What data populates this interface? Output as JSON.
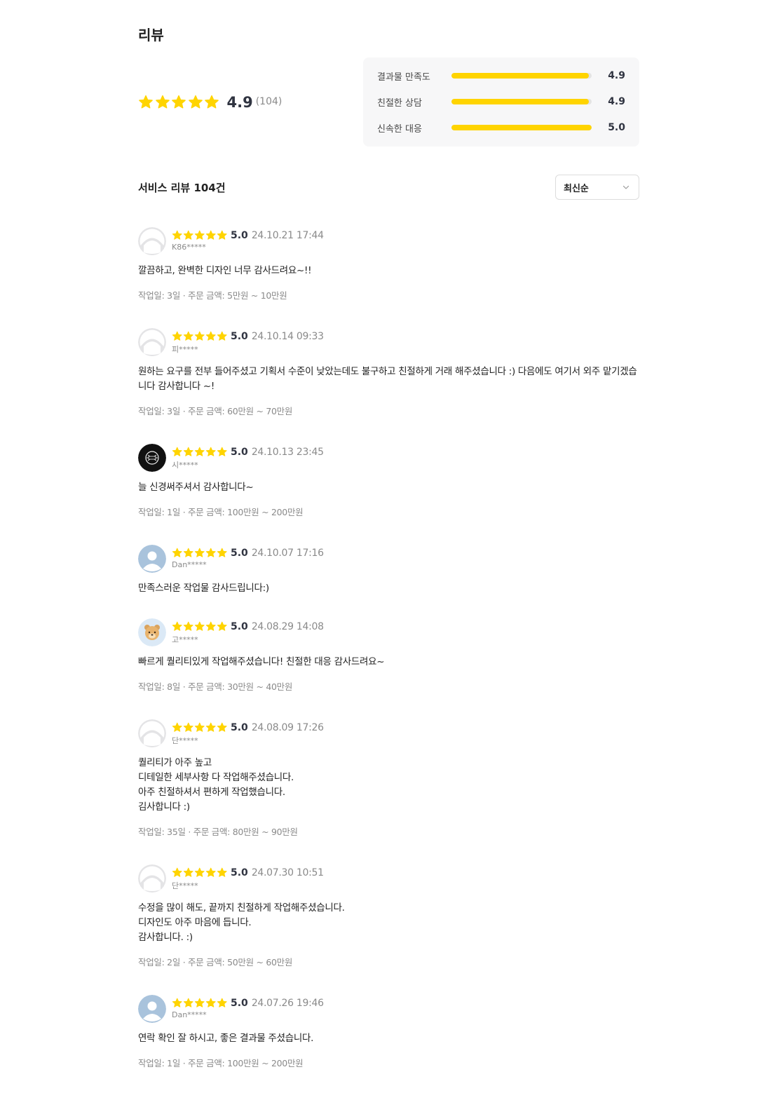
{
  "page": {
    "title": "리뷰"
  },
  "summary": {
    "score": "4.9",
    "count": "(104)",
    "stars": 5,
    "breakdown": [
      {
        "label": "결과물 만족도",
        "score": "4.9",
        "fill": 0.98
      },
      {
        "label": "친절한 상담",
        "score": "4.9",
        "fill": 0.98
      },
      {
        "label": "신속한 대응",
        "score": "5.0",
        "fill": 1.0
      }
    ]
  },
  "list": {
    "title": "서비스 리뷰 104건",
    "sort_label": "최신순"
  },
  "colors": {
    "star": "#FFD400",
    "bar_fill": "#FFD400",
    "bar_track": "#E4E4E4",
    "panel_bg": "#F7F7F8"
  },
  "reviews": [
    {
      "avatar": "default",
      "score": "5.0",
      "date": "24.10.21 17:44",
      "user": "K86*****",
      "body": "깔끔하고, 완벽한 디자인 너무 감사드려요~!!",
      "meta": "작업일: 3일 · 주문 금액: 5만원 ~ 10만원"
    },
    {
      "avatar": "default",
      "score": "5.0",
      "date": "24.10.14 09:33",
      "user": "피*****",
      "body": "원하는 요구를 전부 들어주셨고 기획서 수준이 낮았는데도 불구하고 친절하게 거래 해주셨습니다 :) 다음에도 여기서 외주 맡기겠습니다 감사합니다 ~!",
      "meta": "작업일: 3일 · 주문 금액: 60만원 ~ 70만원"
    },
    {
      "avatar": "dark-logo",
      "score": "5.0",
      "date": "24.10.13 23:45",
      "user": "시*****",
      "body": "늘 신경써주셔서 감사합니다~",
      "meta": "작업일: 1일 · 주문 금액: 100만원 ~ 200만원"
    },
    {
      "avatar": "person",
      "score": "5.0",
      "date": "24.10.07 17:16",
      "user": "Dan*****",
      "body": "만족스러운 작업물 감사드립니다:)",
      "meta": ""
    },
    {
      "avatar": "bear",
      "score": "5.0",
      "date": "24.08.29 14:08",
      "user": "고*****",
      "body": "빠르게 퀄리티있게 작업해주셨습니다! 친절한 대응 감사드려요~",
      "meta": "작업일: 8일 · 주문 금액: 30만원 ~ 40만원"
    },
    {
      "avatar": "default",
      "score": "5.0",
      "date": "24.08.09 17:26",
      "user": "단*****",
      "body": "퀄리티가 아주 높고\n디테일한 세부사항 다 작업해주셨습니다.\n아주 친절하셔서 편하게 작업했습니다.\n김사합니다 :)",
      "meta": "작업일: 35일 · 주문 금액: 80만원 ~ 90만원"
    },
    {
      "avatar": "default",
      "score": "5.0",
      "date": "24.07.30 10:51",
      "user": "단*****",
      "body": "수정을 많이 해도, 끝까지 친절하게 작업해주셨습니다.\n디자인도 아주 마음에 듭니다.\n감사합니다. :)",
      "meta": "작업일: 2일 · 주문 금액: 50만원 ~ 60만원"
    },
    {
      "avatar": "person",
      "score": "5.0",
      "date": "24.07.26 19:46",
      "user": "Dan*****",
      "body": "연락 확인 잘 하시고, 좋은 결과물 주셨습니다.",
      "meta": "작업일: 1일 · 주문 금액: 100만원 ~ 200만원"
    }
  ]
}
